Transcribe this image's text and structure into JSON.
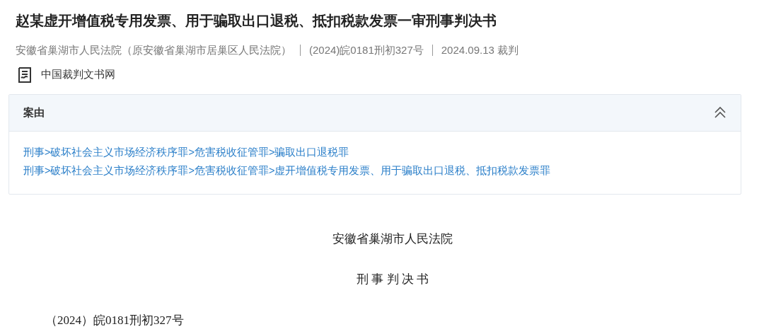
{
  "title": "赵某虚开增值税专用发票、用于骗取出口退税、抵扣税款发票一审刑事判决书",
  "meta": [
    "安徽省巢湖市人民法院（原安徽省巢湖市居巢区人民法院）",
    "(2024)皖0181刑初327号",
    "2024.09.13 裁判"
  ],
  "source": "中国裁判文书网",
  "cause_panel": {
    "heading": "案由",
    "expanded": true,
    "lines": [
      "刑事>破坏社会主义市场经济秩序罪>危害税收征管罪>骗取出口退税罪",
      "刑事>破坏社会主义市场经济秩序罪>危害税收征管罪>虚开增值税专用发票、用于骗取出口退税、抵扣税款发票罪"
    ]
  },
  "document": {
    "court": "安徽省巢湖市人民法院",
    "doc_type": "刑 事 判 决 书",
    "case_number": "（2024）皖0181刑初327号"
  }
}
